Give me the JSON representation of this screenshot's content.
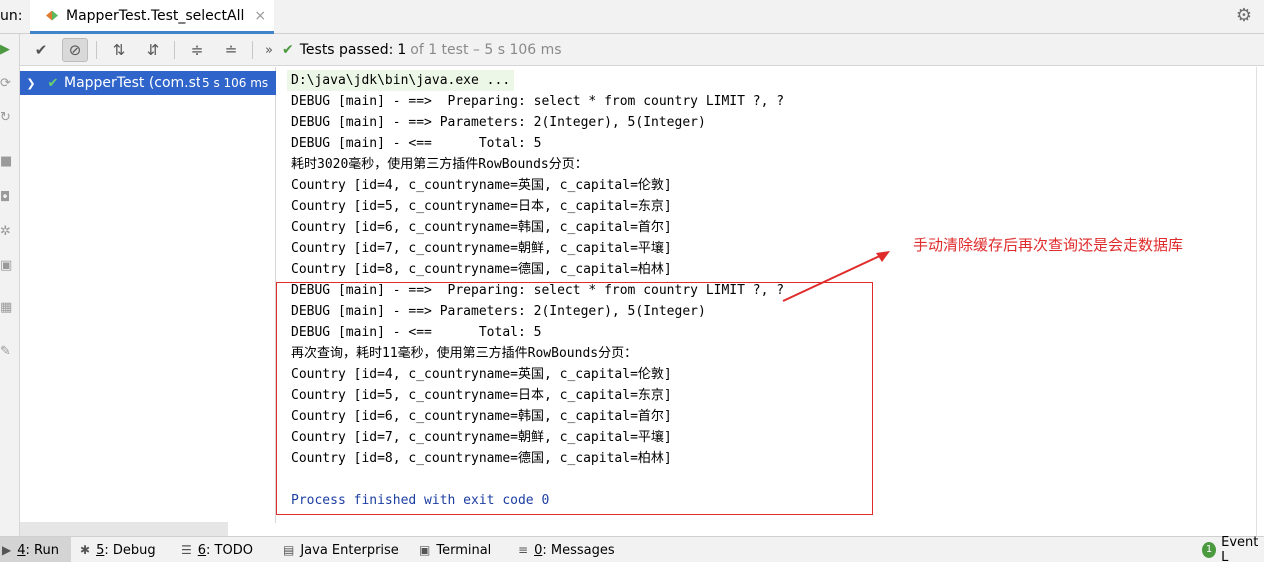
{
  "topbar": {
    "run_label": "un:",
    "tab_title": "MapperTest.Test_selectAll",
    "tab_close": "×"
  },
  "toolbar": {
    "status_passed": "Tests passed:",
    "status_count": "1",
    "status_rest": "of 1 test – 5 s 106 ms",
    "more": "»"
  },
  "tree": {
    "root_name": "MapperTest (com.st",
    "root_duration": "5 s 106 ms"
  },
  "console": {
    "lines": [
      "D:\\java\\jdk\\bin\\java.exe ...",
      "DEBUG [main] - ==>  Preparing: select * from country LIMIT ?, ?",
      "DEBUG [main] - ==> Parameters: 2(Integer), 5(Integer)",
      "DEBUG [main] - <==      Total: 5",
      "耗时3020毫秒，使用第三方插件RowBounds分页：",
      "Country [id=4, c_countryname=英国, c_capital=伦敦]",
      "Country [id=5, c_countryname=日本, c_capital=东京]",
      "Country [id=6, c_countryname=韩国, c_capital=首尔]",
      "Country [id=7, c_countryname=朝鲜, c_capital=平壤]",
      "Country [id=8, c_countryname=德国, c_capital=柏林]",
      "DEBUG [main] - ==>  Preparing: select * from country LIMIT ?, ?",
      "DEBUG [main] - ==> Parameters: 2(Integer), 5(Integer)",
      "DEBUG [main] - <==      Total: 5",
      "再次查询，耗时11毫秒，使用第三方插件RowBounds分页：",
      "Country [id=4, c_countryname=英国, c_capital=伦敦]",
      "Country [id=5, c_countryname=日本, c_capital=东京]",
      "Country [id=6, c_countryname=韩国, c_capital=首尔]",
      "Country [id=7, c_countryname=朝鲜, c_capital=平壤]",
      "Country [id=8, c_countryname=德国, c_capital=柏林]",
      "",
      "Process finished with exit code 0"
    ]
  },
  "annotation": {
    "text": "手动清除缓存后再次查询还是会走数据库",
    "color": "#e02b2b"
  },
  "bottombar": {
    "items": [
      {
        "mnemonic": "4",
        "label": ": Run"
      },
      {
        "mnemonic": "5",
        "label": ": Debug"
      },
      {
        "mnemonic": "6",
        "label": ": TODO"
      },
      {
        "mnemonic": "",
        "label": "Java Enterprise"
      },
      {
        "mnemonic": "",
        "label": "Terminal"
      },
      {
        "mnemonic": "0",
        "label": ": Messages"
      }
    ],
    "event_badge": "1",
    "event_label": "Event L"
  },
  "colors": {
    "selection": "#2f65ca",
    "pass_green": "#4c9a3f",
    "exit_text": "#1c3ea1"
  }
}
